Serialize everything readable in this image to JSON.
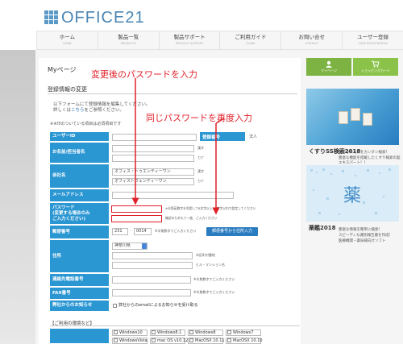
{
  "header": {
    "logo_text": "OFFICE21"
  },
  "nav": {
    "items": [
      {
        "label": "ホーム",
        "sub": "HOME"
      },
      {
        "label": "製品一覧",
        "sub": "PRODUCTS"
      },
      {
        "label": "製品サポート",
        "sub": "PRODUCT SUPPORT"
      },
      {
        "label": "ご利用ガイド",
        "sub": "GUIDE"
      },
      {
        "label": "お問い合せ",
        "sub": "CONTACT"
      },
      {
        "label": "ユーザー登録",
        "sub": "USER REGISTRATION"
      }
    ]
  },
  "page": {
    "title": "Myページ",
    "section_title": "登録情報の変更",
    "intro_line1": "以下フォームにて登録情報を編集してください。",
    "intro_line2_pre": "詳しくは",
    "intro_line2_link": "こちら",
    "intro_line2_post": "をご参照ください。",
    "required_note": "※※印のついている項目は必須項目です"
  },
  "form": {
    "user_id_label": "ユーザーID",
    "register_no_label": "登録番号",
    "register_no_value": "法人",
    "name_label": "お名前/担当者名",
    "name_kanji_hint": "漢字",
    "name_kana_hint": "カナ",
    "company_label": "会社名",
    "company_kanji": "オフィス・トゥエンティーワン",
    "company_kana": "オフィストウェンティーワン",
    "company_kanji_hint": "漢字",
    "company_kana_hint": "カナ",
    "email_label": "メールアドレス",
    "password_label": "パスワード",
    "password_label2": "(変更する場合のみ",
    "password_label3": "ご入力ください)",
    "password_hint": "※半角英数字を利用して8文字以上15文字以内で設定してください",
    "password_confirm_hint": "確認のためもう一度、ご入力ください",
    "zip_label": "郵便番号",
    "zip1": "231",
    "zip2": "0014",
    "zip_hint": "※半角数字でご入力ください",
    "zip_button": "郵便番号から住所入力",
    "address_label": "住所",
    "pref_value": "神奈川県",
    "city_hint": "市区町村番地",
    "building_hint": "ビル・マンション名",
    "phone_label": "連絡先電話番号",
    "phone_hint": "※半角数字でご入力ください",
    "fax_label": "FAX番号",
    "fax_hint": "※半角数字でご入力ください",
    "notice_label": "弊社からのお知らせ",
    "notice_text": "弊社からのemailによるお知らせを受け取る"
  },
  "env": {
    "title": "【ご利用の環境など】",
    "os_row1": [
      "Windows10",
      "Windows8.1",
      "Windows8",
      "Windows7"
    ],
    "os_row2": [
      "WindowsVista",
      "mac OS v10.12",
      "MacOSX 10.11",
      "MacOSX 10.10"
    ]
  },
  "sidebar": {
    "mypage_button": "マイページ",
    "cart_button": "ショッピングカート",
    "kusuri_title": "くすりSS検索2018",
    "kusuri_desc1": "処方された薬をカンタン検索！",
    "kusuri_desc2": "豊富な機能を搭載したくすり検索の超エキスパート！！",
    "yakkan_title": "薬鑑2018",
    "yakkan_desc1": "豊富な情報を簡単に検索！",
    "yakkan_desc2": "スピーディな識別報告書を作成！",
    "yakkan_desc3": "医療機関・薬局様向けソフト"
  },
  "annotations": {
    "new_password": "変更後のパスワードを入力",
    "confirm_password": "同じパスワードを再度入力"
  },
  "colors": {
    "label_blue": "#2a96d2",
    "annotation_red": "#e0202a",
    "sidebar_green": "#7cb342"
  }
}
